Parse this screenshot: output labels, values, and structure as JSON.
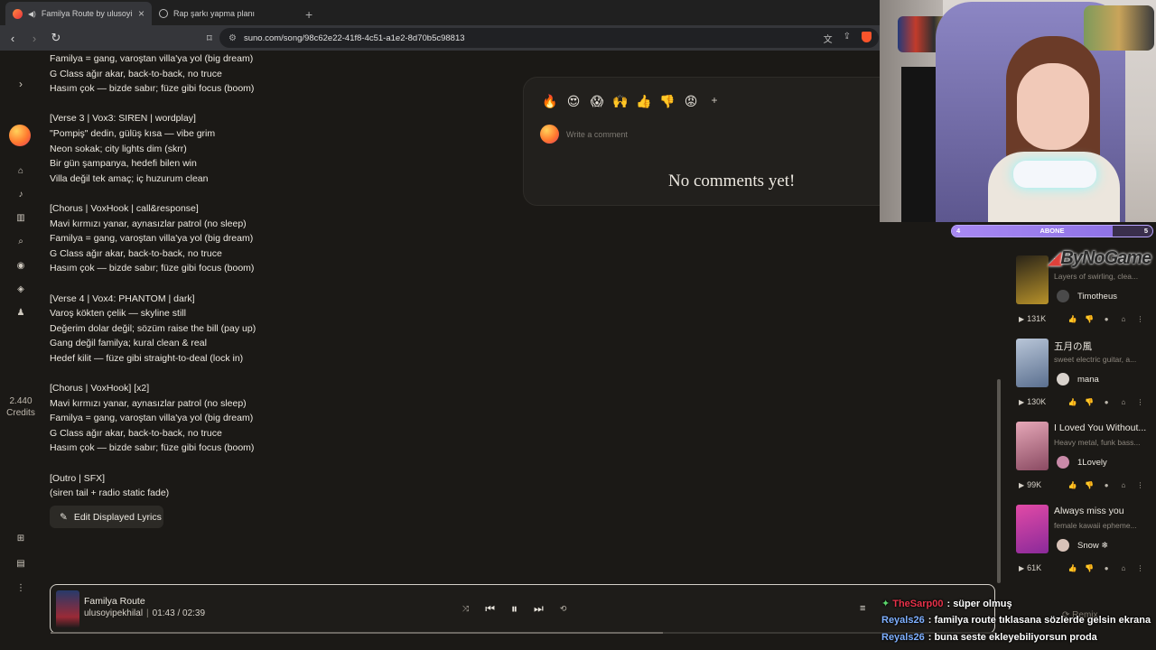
{
  "browser": {
    "tabs": [
      {
        "title": "Familya Route by ulusoyipekhi",
        "active": true
      },
      {
        "title": "Rap şarkı yapma planı",
        "active": false
      }
    ],
    "url": "suno.com/song/98c62e22-41f8-4c51-a1e2-8d70b5c98813"
  },
  "sidebar": {
    "credits_amount": "2.440",
    "credits_label": "Credits",
    "icons": [
      "chevron-right-icon",
      "avatar",
      "home-icon",
      "music-note-icon",
      "library-icon",
      "search-icon",
      "radio-icon",
      "explore-icon",
      "bell-icon",
      "gift-icon",
      "document-icon",
      "more-icon"
    ]
  },
  "lyrics": [
    "Familya = gang, varoştan villa'ya yol (big dream)",
    "G Class ağır akar, back-to-back, no truce",
    "Hasım çok — bizde sabır; füze gibi focus (boom)",
    "",
    "[Verse 3 | Vox3: SIREN | wordplay]",
    "\"Pompiş\" dedin, gülüş kısa — vibe grim",
    "Neon sokak; city lights dim (skrr)",
    "Bir gün şampanya, hedefi bilen win",
    "Villa değil tek amaç; iç huzurum clean",
    "",
    "[Chorus | VoxHook | call&response]",
    "Mavi kırmızı yanar, aynasızlar patrol (no sleep)",
    "Familya = gang, varoştan villa'ya yol (big dream)",
    "G Class ağır akar, back-to-back, no truce",
    "Hasım çok — bizde sabır; füze gibi focus (boom)",
    "",
    "[Verse 4 | Vox4: PHANTOM | dark]",
    "Varoş kökten çelik — skyline still",
    "Değerim dolar değil; sözüm raise the bill (pay up)",
    "Gang değil familya; kural clean & real",
    "Hedef kilit — füze gibi straight-to-deal (lock in)",
    "",
    "[Chorus | VoxHook] [x2]",
    "Mavi kırmızı yanar, aynasızlar patrol (no sleep)",
    "Familya = gang, varoştan villa'ya yol (big dream)",
    "G Class ağır akar, back-to-back, no truce",
    "Hasım çok — bizde sabır; füze gibi focus (boom)",
    "",
    "[Outro | SFX]",
    "(siren tail + radio static fade)"
  ],
  "edit_lyrics_label": "Edit Displayed Lyrics",
  "comments": {
    "reactions": [
      "🔥",
      "😍",
      "😱",
      "🙌",
      "👍",
      "👎",
      "😡",
      "+"
    ],
    "placeholder": "Write a comment",
    "empty_text": "No comments yet!"
  },
  "stream_overlay": {
    "sub_goal_label": "ABONE",
    "sub_goal_current": "4",
    "sub_goal_target": "5",
    "sub_goal_progress": 0.8,
    "logo_text": "ByNoGame",
    "chat": [
      {
        "user": "TheSarp00",
        "user_color": "#e8324a",
        "text": ": süper olmuş"
      },
      {
        "user": "Reyals26",
        "user_color": "#7fb0ff",
        "text": ": familya route tıklasana sözlerde gelsin ekrana"
      },
      {
        "user": "Reyals26",
        "user_color": "#7fb0ff",
        "text": ": buna seste ekleyebiliyorsun proda"
      }
    ]
  },
  "related_songs": [
    {
      "title": "Tr",
      "desc": "Layers of swirling, clea...",
      "user": "Timotheus",
      "plays": "131K",
      "thumb": "#2a2418",
      "thumb2": "#b8922a",
      "avatar": "#4a4a4a"
    },
    {
      "title": "五月の風",
      "desc": "sweet electric guitar, a...",
      "user": "mana",
      "plays": "130K",
      "thumb": "#b9c6d8",
      "thumb2": "#5a6f8f",
      "avatar": "#d8d2cc"
    },
    {
      "title": "I Loved You Without...",
      "desc": "Heavy metal, funk bass...",
      "user": "1Lovely",
      "plays": "99K",
      "thumb": "#e6a8b8",
      "thumb2": "#8a4a62",
      "avatar": "#c98aa8"
    },
    {
      "title": "Always miss you",
      "desc": "female kawaii epheme...",
      "user": "Snow ❄",
      "plays": "61K",
      "thumb": "#e24aa6",
      "thumb2": "#8a2a9a",
      "avatar": "#d8c2b8"
    }
  ],
  "player": {
    "title": "Familya Route",
    "artist": "ulusoyipekhilal",
    "current_time": "01:43",
    "separator": "/",
    "duration": "02:39",
    "progress": 0.648
  },
  "remix_label": "Remix"
}
